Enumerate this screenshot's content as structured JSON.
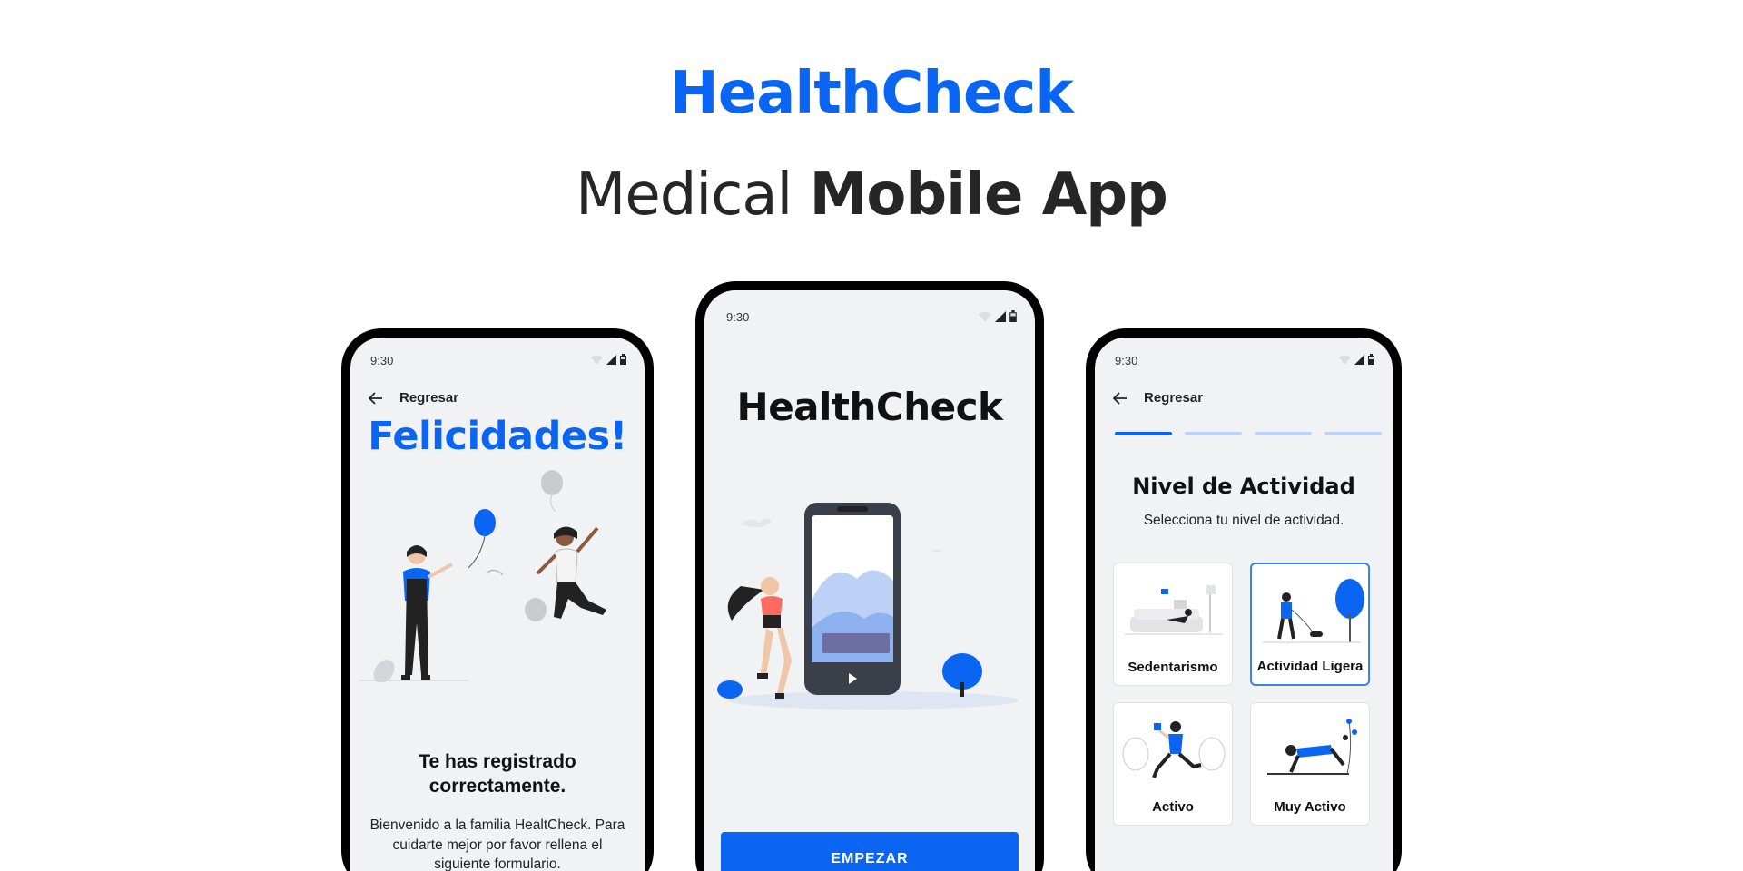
{
  "header": {
    "brand": "HealthCheck",
    "subtitle_regular": "Medical ",
    "subtitle_bold": "Mobile App",
    "brand_color": "#0a66f2"
  },
  "left_screen": {
    "status_time": "9:30",
    "back_label": "Regresar",
    "heading": "Felicidades!",
    "registered_text": "Te has registrado correctamente.",
    "welcome_text": "Bienvenido a la familia HealtCheck. Para cuidarte mejor por favor rellena el siguiente formulario."
  },
  "center_screen": {
    "status_time": "9:30",
    "title": "HealthCheck",
    "start_button": "EMPEZAR"
  },
  "right_screen": {
    "status_time": "9:30",
    "back_label": "Regresar",
    "progress_steps": 4,
    "progress_current": 1,
    "title": "Nivel de Actividad",
    "subtitle": "Selecciona tu nivel de actividad.",
    "options": [
      {
        "label": "Sedentarismo",
        "selected": false
      },
      {
        "label": "Actividad Ligera",
        "selected": true
      },
      {
        "label": "Activo",
        "selected": false
      },
      {
        "label": "Muy Activo",
        "selected": false
      }
    ]
  },
  "icons": [
    "back-arrow-icon",
    "wifi-icon",
    "signal-icon",
    "battery-icon",
    "play-icon"
  ]
}
